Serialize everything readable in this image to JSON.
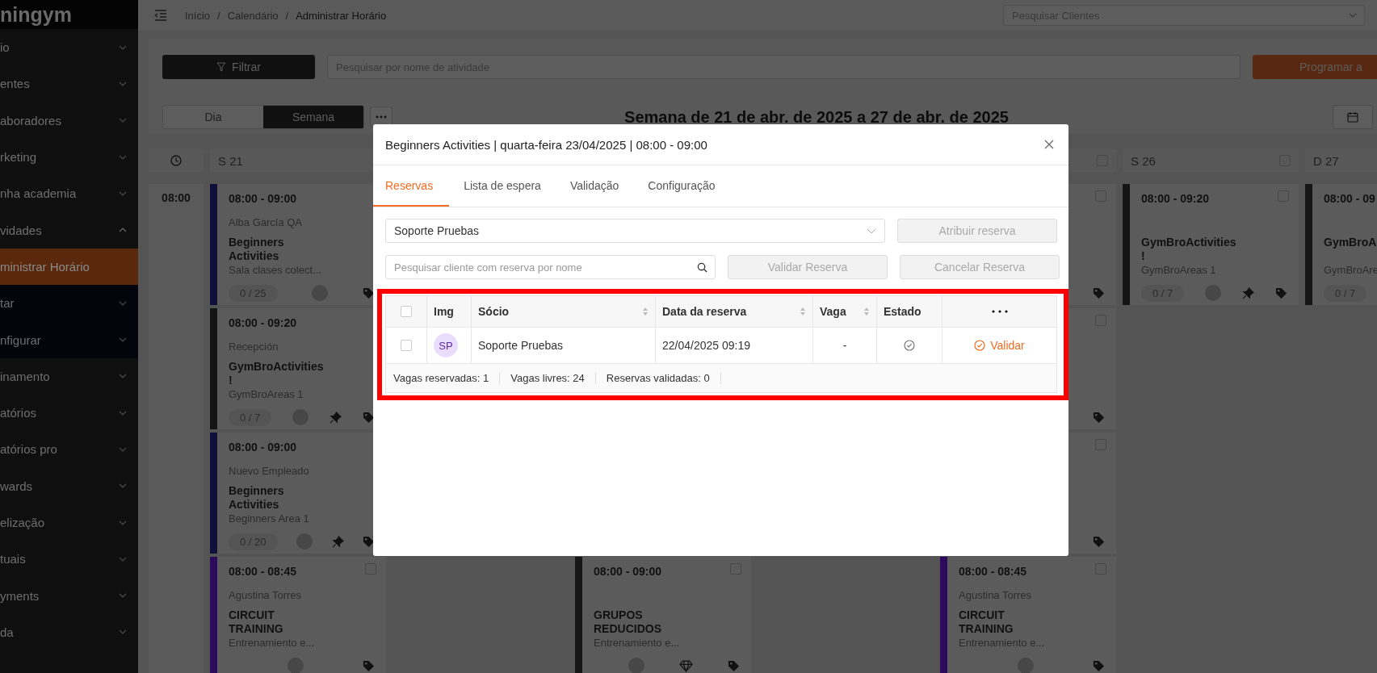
{
  "sidebar": {
    "logo": "ningym",
    "items": [
      {
        "label": "io",
        "selected": false,
        "expanded": false
      },
      {
        "label": "entes",
        "selected": false,
        "expanded": false
      },
      {
        "label": "aboradores",
        "selected": false,
        "expanded": false
      },
      {
        "label": "rketing",
        "selected": false,
        "expanded": false
      },
      {
        "label": "nha academia",
        "selected": false,
        "expanded": false
      },
      {
        "label": "vidades",
        "selected": false,
        "expanded": true,
        "children": [
          {
            "label": "ministrar Horário",
            "selected": true
          },
          {
            "label": "tar",
            "selected": false,
            "expanded": false
          },
          {
            "label": "nfigurar",
            "selected": false,
            "expanded": false
          }
        ]
      },
      {
        "label": "inamento",
        "selected": false,
        "expanded": false
      },
      {
        "label": "atórios",
        "selected": false,
        "expanded": false
      },
      {
        "label": "atórios pro",
        "selected": false,
        "expanded": false
      },
      {
        "label": "wards",
        "selected": false,
        "expanded": false
      },
      {
        "label": "elização",
        "selected": false,
        "expanded": false
      },
      {
        "label": "tuais",
        "selected": false,
        "expanded": false
      },
      {
        "label": "yments",
        "selected": false,
        "expanded": false
      },
      {
        "label": "da",
        "selected": false,
        "expanded": false
      }
    ]
  },
  "topbar": {
    "breadcrumbs": [
      "Início",
      "Calendário",
      "Administrar Horário"
    ],
    "breadcrumb_separator": "/",
    "client_search": {
      "placeholder": "Pesquisar Clientes"
    }
  },
  "toolbar": {
    "filter_button": "Filtrar",
    "activity_search": {
      "placeholder": "Pesquisar por nome de atividade"
    },
    "schedule_button": "Programar a"
  },
  "view_tabs": [
    {
      "label": "Dia",
      "selected": false
    },
    {
      "label": "Semana",
      "selected": true
    }
  ],
  "week_title": "Semana de 21 de abr. de 2025 a 27 de abr. de 2025",
  "calendar": {
    "time_slots": [
      "08:00"
    ],
    "days": {
      "mon": {
        "label": "S 21",
        "cards": {
          "r1": {
            "color": "#10103a",
            "time": "08:00 - 09:00",
            "teacher": "Alba García QA",
            "name": "Beginners Activities",
            "room": "Sala clases colect...",
            "capacity": "0 / 25",
            "icons": [
              {
                "kind": "avatar"
              },
              {
                "kind": "tag"
              }
            ]
          },
          "r2": {
            "color": "#151515",
            "time": "08:00 - 09:20",
            "teacher": "Recepción",
            "name": "GymBroActivities !",
            "room": "GymBroAreas 1",
            "capacity": "0 / 7",
            "icons": [
              {
                "kind": "avatar"
              },
              {
                "kind": "pin"
              },
              {
                "kind": "tag"
              }
            ]
          },
          "r3": {
            "color": "#10103a",
            "time": "08:00 - 09:00",
            "teacher": "Nuevo Empleado",
            "name": "Beginners Activities",
            "room": "Beginners Area 1",
            "capacity": "0 / 20",
            "icons": [
              {
                "kind": "avatar"
              },
              {
                "kind": "pin"
              },
              {
                "kind": "tag"
              }
            ]
          },
          "r4": {
            "color": "#2e0a5e",
            "time": "08:00 - 08:45",
            "teacher": "Agustina Torres",
            "name": "CIRCUIT TRAINING",
            "room": "Entrenamiento e...",
            "checked": false,
            "icons": [
              {
                "kind": "avatar"
              },
              {
                "kind": "tag"
              }
            ]
          }
        }
      },
      "wed": {
        "cards": {
          "r4": {
            "color": "#151515",
            "time": "08:00 - 09:00",
            "name": "GRUPOS REDUCIDOS",
            "room": "Entrenamiento e...",
            "checked": false,
            "icons": [
              {
                "kind": "avatar"
              },
              {
                "kind": "gem"
              },
              {
                "kind": "tag"
              }
            ]
          }
        }
      },
      "fri": {
        "checked": false,
        "cards": {
          "r1": {
            "checked": false,
            "icons": [
              {
                "kind": "tag"
              }
            ]
          },
          "r2": {
            "checked": false,
            "icons": [
              {
                "kind": "tag"
              }
            ]
          },
          "r3": {
            "checked": false,
            "icons": [
              {
                "kind": "tag"
              }
            ]
          },
          "r4": {
            "color": "#2e0a5e",
            "time": "08:00 - 08:45",
            "teacher": "Agustina Torres",
            "name": "CIRCUIT TRAINING",
            "room": "Entrenamiento e...",
            "checked": false,
            "icons": [
              {
                "kind": "avatar"
              },
              {
                "kind": "tag"
              }
            ]
          }
        }
      },
      "sat": {
        "label": "S 26",
        "checked": false,
        "cards": {
          "r1": {
            "color": "#151515",
            "time": "08:00 - 09:20",
            "name": "GymBroActivities !",
            "room": "GymBroAreas 1",
            "capacity": "0 / 7",
            "checked": false,
            "icons": [
              {
                "kind": "avatar"
              },
              {
                "kind": "pin"
              },
              {
                "kind": "tag"
              }
            ]
          }
        }
      },
      "sun": {
        "label": "D 27",
        "cards": {
          "r1": {
            "color": "#151515",
            "time": "08:00 - 09",
            "name": "GymBroA",
            "room": "GymBroAre",
            "capacity": "0 / 7"
          }
        }
      }
    }
  },
  "modal": {
    "title": "Beginners Activities | quarta-feira 23/04/2025 | 08:00 - 09:00",
    "tabs": [
      {
        "label": "Reservas",
        "selected": true
      },
      {
        "label": "Lista de espera",
        "selected": false
      },
      {
        "label": "Validação",
        "selected": false
      },
      {
        "label": "Configuração",
        "selected": false
      }
    ],
    "client_select": {
      "value": "Soporte Pruebas"
    },
    "assign_button": {
      "label": "Atribuir reserva",
      "disabled": true
    },
    "booking_search": {
      "placeholder": "Pesquisar cliente com reserva por nome"
    },
    "validate_button": {
      "label": "Validar Reserva",
      "disabled": true
    },
    "cancel_button": {
      "label": "Cancelar Reserva",
      "disabled": true
    },
    "table": {
      "select_all": {
        "checked": false
      },
      "columns": [
        {
          "label": "Img",
          "sortable": false
        },
        {
          "label": "Sócio",
          "sortable": true
        },
        {
          "label": "Data da reserva",
          "sortable": true
        },
        {
          "label": "Vaga",
          "sortable": true
        },
        {
          "label": "Estado",
          "sortable": false
        }
      ],
      "rows": [
        {
          "checked": false,
          "initials": "SP",
          "member": "Soporte Pruebas",
          "date": "22/04/2025 09:19",
          "spot": "-",
          "validated": false,
          "action": "Validar"
        }
      ],
      "summary": [
        "Vagas reservadas: 1",
        "Vagas livres: 24",
        "Reservas validadas: 0"
      ]
    }
  }
}
